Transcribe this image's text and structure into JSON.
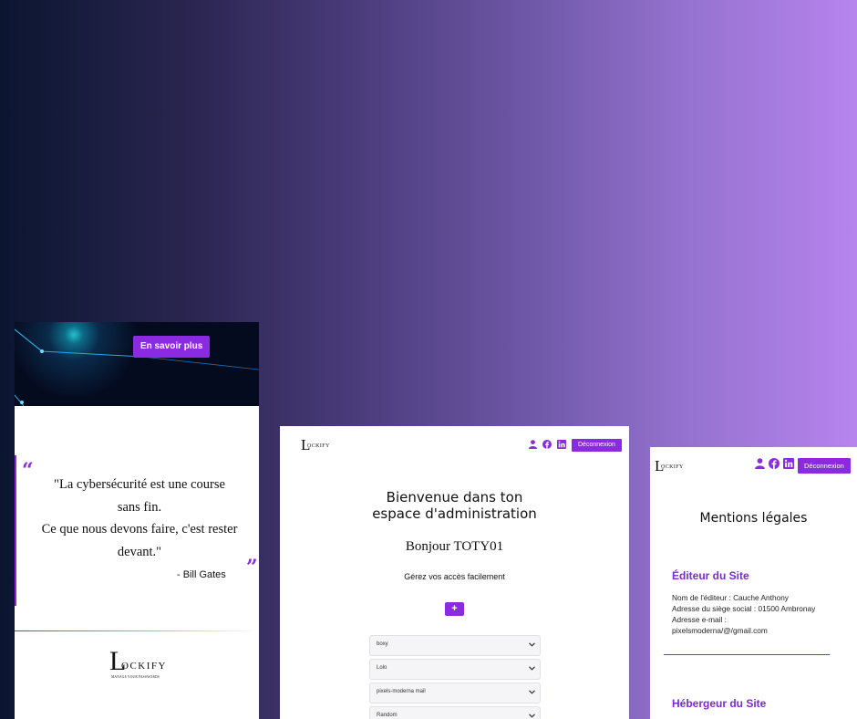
{
  "left": {
    "hero_button": "En savoir plus",
    "quote_open": "“",
    "quote_close": "”",
    "quote_line1": "\"La cybersécurité est une course",
    "quote_line2": "sans fin.",
    "quote_line3": "Ce que nous devons faire, c'est rester",
    "quote_line4": "devant.\"",
    "quote_author": "- Bill Gates",
    "brand_initial": "L",
    "brand_word": "OCKIFY",
    "brand_tagline": "MANAGE YOUR PASSWORDS"
  },
  "center": {
    "logo_initial": "L",
    "logo_word": "OCKIFY",
    "logout_label": "Déconnexion",
    "title_line1": "Bienvenue dans ton",
    "title_line2": "espace d'administration",
    "greeting": "Bonjour TOTY01",
    "subtitle": "Gérez vos accès facilement",
    "add_label": "+",
    "accounts": [
      "boxy",
      "Lolo",
      "pixels-moderna mail",
      "Random"
    ]
  },
  "right": {
    "logo_initial": "L",
    "logo_word": "OCKIFY",
    "logout_label": "Déconnexion",
    "page_title": "Mentions légales",
    "section1_title": "Éditeur du Site",
    "section1_lines": [
      "Nom de l'éditeur : Cauche Anthony",
      "Adresse du siège social : 01500 Ambronay",
      "Adresse e-mail :",
      "pixelsmoderna/@/gmail.com"
    ],
    "section2_title": "Hébergeur du Site"
  },
  "colors": {
    "accent": "#8a2be2",
    "heading_accent": "#7b2ad0"
  },
  "icons": [
    "user-icon",
    "facebook-icon",
    "linkedin-icon",
    "chevron-down-icon"
  ]
}
